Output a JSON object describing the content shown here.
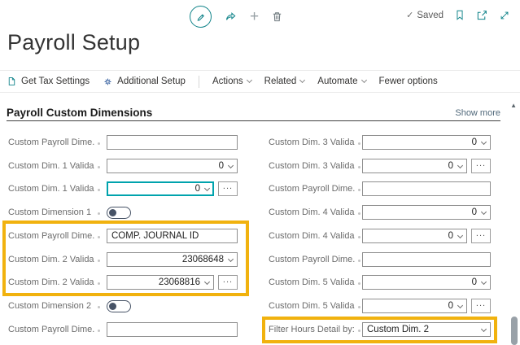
{
  "page": {
    "title": "Payroll Setup"
  },
  "toolbar": {
    "saved_label": "Saved",
    "icons": [
      "edit-pencil-icon",
      "share-icon",
      "add-icon",
      "delete-trash-icon",
      "bookmark-icon",
      "open-in-window-icon",
      "expand-icon"
    ]
  },
  "glyphs": {
    "check": "✓",
    "plus": "+",
    "up_arrow": "▲",
    "dots": "..."
  },
  "action_bar": {
    "items": [
      {
        "label": "Get Tax Settings",
        "icon": "document-icon"
      },
      {
        "label": "Additional Setup",
        "icon": "setup-gear-icon"
      },
      {
        "label": "Actions",
        "chevron": true,
        "divider_before": true
      },
      {
        "label": "Related",
        "chevron": true
      },
      {
        "label": "Automate",
        "chevron": true
      },
      {
        "label": "Fewer options"
      }
    ]
  },
  "section": {
    "title": "Payroll Custom Dimensions",
    "show_more_label": "Show more"
  },
  "form": {
    "left": [
      {
        "label": "Custom Payroll Dime...",
        "type": "input",
        "value": ""
      },
      {
        "label": "Custom Dim. 1 Valida...",
        "type": "combo",
        "value": "0"
      },
      {
        "label": "Custom Dim. 1 Valida...",
        "type": "combo",
        "value": "0",
        "dots": true,
        "focused": true
      },
      {
        "label": "Custom Dimension 1 ...",
        "type": "toggle",
        "value": "off"
      },
      {
        "label": "Custom Payroll Dime...",
        "type": "input",
        "value": "COMP. JOURNAL ID",
        "highlight": true
      },
      {
        "label": "Custom Dim. 2 Valida...",
        "type": "combo",
        "value": "23068648",
        "highlight": true
      },
      {
        "label": "Custom Dim. 2 Valida...",
        "type": "combo",
        "value": "23068816",
        "dots": true,
        "highlight": true
      },
      {
        "label": "Custom Dimension 2 ...",
        "type": "toggle",
        "value": "off"
      },
      {
        "label": "Custom Payroll Dime...",
        "type": "input",
        "value": ""
      }
    ],
    "right": [
      {
        "label": "Custom Dim. 3 Valida...",
        "type": "combo",
        "value": "0"
      },
      {
        "label": "Custom Dim. 3 Valida...",
        "type": "combo",
        "value": "0",
        "dots": true
      },
      {
        "label": "Custom Payroll Dime...",
        "type": "input",
        "value": ""
      },
      {
        "label": "Custom Dim. 4 Valida...",
        "type": "combo",
        "value": "0"
      },
      {
        "label": "Custom Dim. 4 Valida...",
        "type": "combo",
        "value": "0",
        "dots": true
      },
      {
        "label": "Custom Payroll Dime...",
        "type": "input",
        "value": ""
      },
      {
        "label": "Custom Dim. 5 Valida...",
        "type": "combo",
        "value": "0"
      },
      {
        "label": "Custom Dim. 5 Valida...",
        "type": "combo",
        "value": "0",
        "dots": true
      },
      {
        "label": "Filter Hours Detail by:",
        "type": "combo",
        "value": "Custom Dim. 2",
        "align": "left",
        "highlight": true
      }
    ]
  },
  "colors": {
    "accent_teal": "#0f8389",
    "focus_border": "#00a3ad",
    "highlight_orange": "#f1b20e",
    "setup_icon_blue": "#2b579a",
    "toggle_slate": "#475366"
  }
}
